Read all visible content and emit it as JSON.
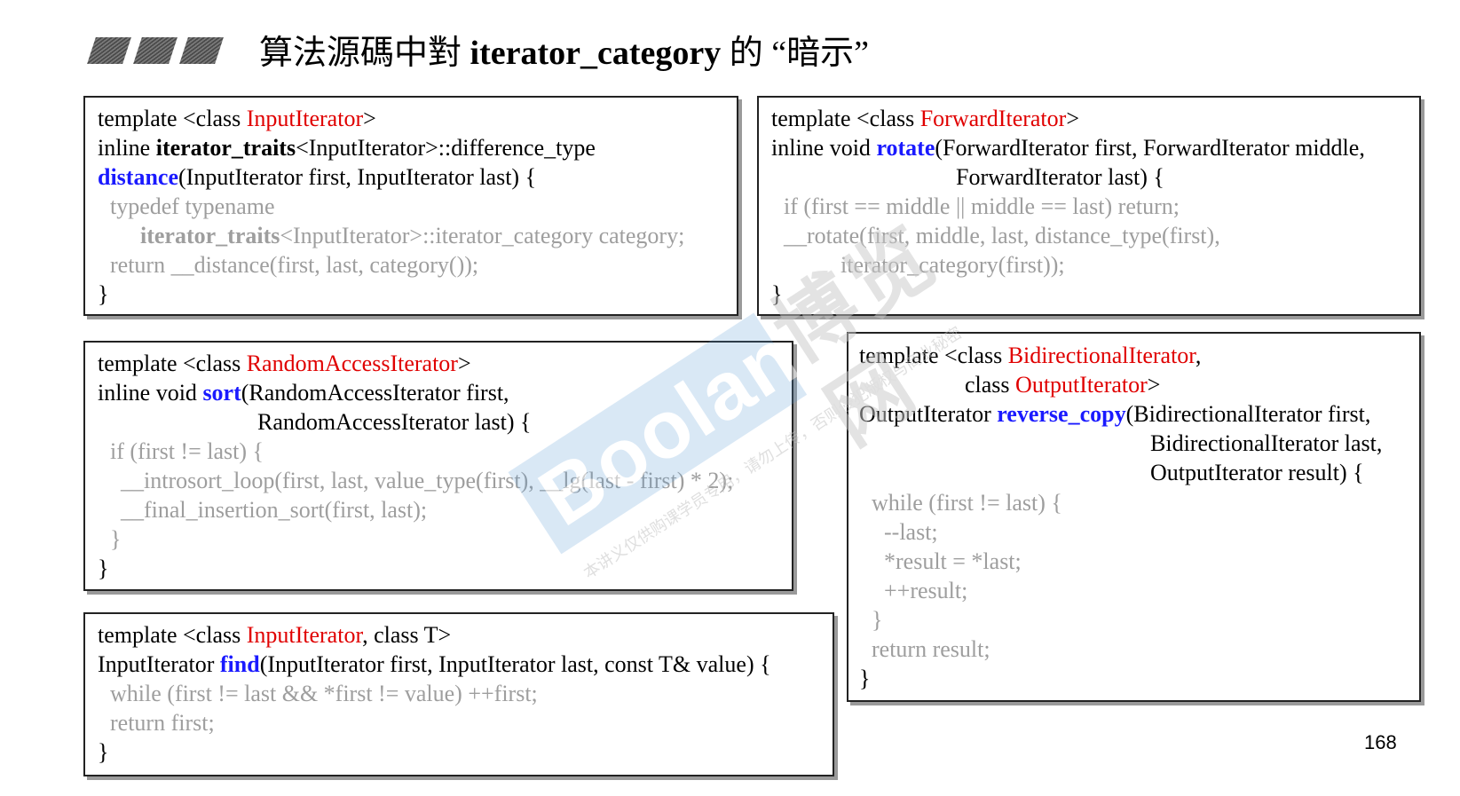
{
  "title": {
    "prefix": "算法源碼中對 ",
    "keyword": "iterator_category",
    "suffix": " 的 “暗示”"
  },
  "page_number": "168",
  "watermark": {
    "brand": "Boolan",
    "chinese": "博览网",
    "notice": "本讲义仅供购课学员专用，请勿上传，否则侵犯版权与商业秘密"
  },
  "boxes": {
    "distance": {
      "l1_a": "template <class ",
      "l1_b": "InputIterator",
      "l1_c": ">",
      "l2_a": "inline ",
      "l2_b": "iterator_traits",
      "l2_c": "<InputIterator>::difference_type",
      "l3_a": "distance",
      "l3_b": "(InputIterator first, InputIterator last) {",
      "l4": "typedef typename",
      "l5_a": "iterator_traits",
      "l5_b": "<InputIterator>::iterator_category category;",
      "l6": "return __distance(first, last, category());",
      "l7": "}"
    },
    "rotate": {
      "l1_a": "template <class ",
      "l1_b": "ForwardIterator",
      "l1_c": ">",
      "l2_a": "inline void ",
      "l2_b": "rotate",
      "l2_c": "(ForwardIterator first, ForwardIterator middle,",
      "l3": "ForwardIterator last) {",
      "l4": "if (first == middle || middle == last) return;",
      "l5": "__rotate(first, middle, last, distance_type(first),",
      "l6": "iterator_category(first));",
      "l7": "}"
    },
    "sort": {
      "l1_a": "template <class ",
      "l1_b": "RandomAccessIterator",
      "l1_c": ">",
      "l2_a": "inline void ",
      "l2_b": "sort",
      "l2_c": "(RandomAccessIterator first,",
      "l3": "RandomAccessIterator last) {",
      "l4": "if (first != last) {",
      "l5": "__introsort_loop(first, last, value_type(first), __lg(last - first) * 2);",
      "l6": "__final_insertion_sort(first, last);",
      "l7": "}",
      "l8": "}"
    },
    "find": {
      "l1_a": "template <class ",
      "l1_b": "InputIterator",
      "l1_c": ", class T>",
      "l2_a": "InputIterator ",
      "l2_b": "find",
      "l2_c": "(InputIterator first, InputIterator last, const T& value) {",
      "l3": "while (first != last && *first != value) ++first;",
      "l4": "return first;",
      "l5": "}"
    },
    "reverse_copy": {
      "l1_a": "template <class ",
      "l1_b": "BidirectionalIterator",
      "l1_c": ",",
      "l2_a": "class ",
      "l2_b": "OutputIterator",
      "l2_c": ">",
      "l3_a": "OutputIterator ",
      "l3_b": "reverse_copy",
      "l3_c": "(BidirectionalIterator first,",
      "l4": "BidirectionalIterator last,",
      "l5": "OutputIterator result) {",
      "l6": "while (first != last) {",
      "l7": "--last;",
      "l8": "*result = *last;",
      "l9": "++result;",
      "l10": "}",
      "l11": "return result;",
      "l12": "}"
    }
  }
}
